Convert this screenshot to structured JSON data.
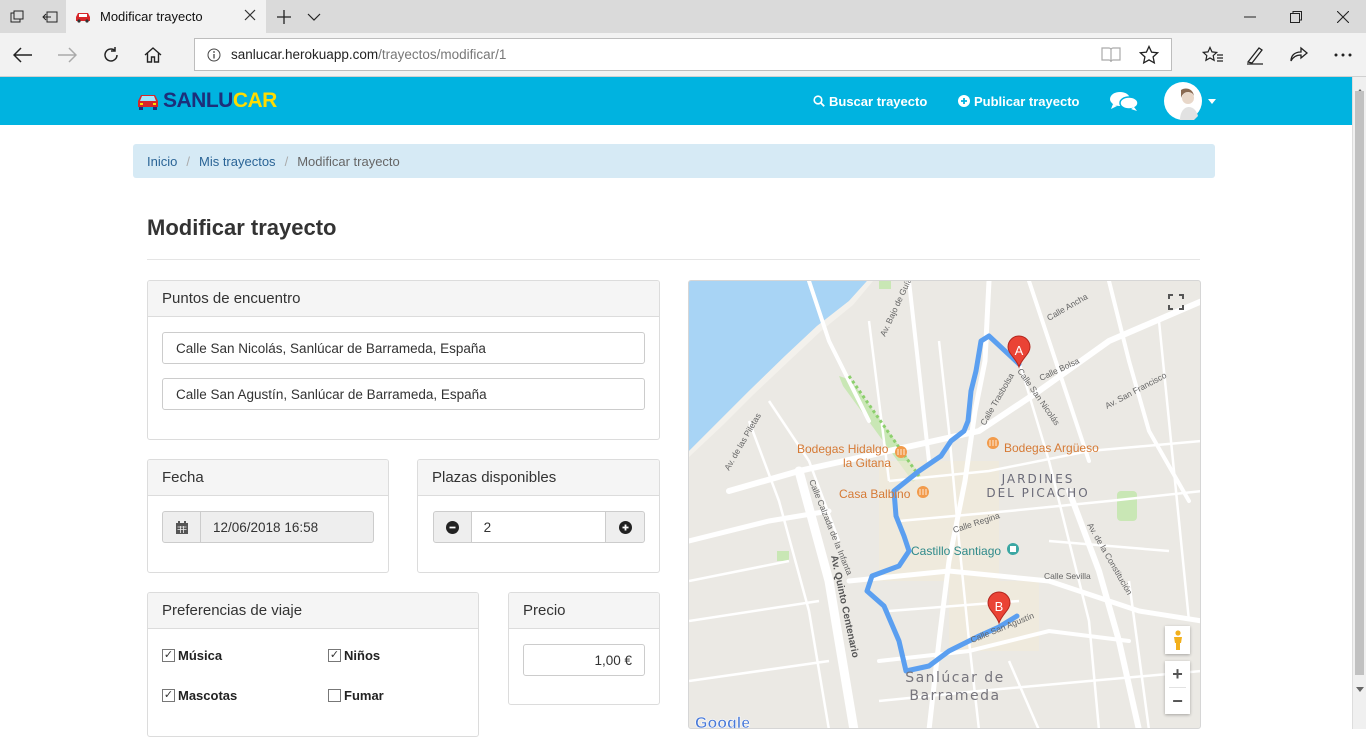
{
  "browser": {
    "tab_title": "Modificar trayecto",
    "url_host": "sanlucar.herokuapp.com",
    "url_path": "/trayectos/modificar/1",
    "icons": [
      "tab-manager-icon",
      "back-tabs-icon",
      "car-favicon",
      "close-icon",
      "plus-icon",
      "chevron-down-icon",
      "minimize-icon",
      "restore-icon",
      "close-window-icon",
      "back-arrow-icon",
      "forward-arrow-icon",
      "refresh-icon",
      "home-icon",
      "info-icon",
      "reading-view-icon",
      "star-icon",
      "favorites-icon",
      "pen-icon",
      "share-icon",
      "more-icon"
    ]
  },
  "navbar": {
    "logo_part1": "SANLU",
    "logo_part2": "CAR",
    "search_label": "Buscar trayecto",
    "publish_label": "Publicar trayecto",
    "brand_colors": {
      "bar": "#00b3e0",
      "logo_blue": "#1d2f7a",
      "logo_yellow": "#ffdc00",
      "logo_car": "#d7262a"
    }
  },
  "breadcrumb": {
    "items": [
      "Inicio",
      "Mis trayectos"
    ],
    "current": "Modificar trayecto"
  },
  "page": {
    "title": "Modificar trayecto"
  },
  "meeting_points": {
    "heading": "Puntos de encuentro",
    "origin": "Calle San Nicolás, Sanlúcar de Barrameda, España",
    "destination": "Calle San Agustín, Sanlúcar de Barrameda, España"
  },
  "date": {
    "heading": "Fecha",
    "value": "12/06/2018 16:58"
  },
  "seats": {
    "heading": "Plazas disponibles",
    "value": "2"
  },
  "preferences": {
    "heading": "Preferencias de viaje",
    "options": [
      {
        "label": "Música",
        "checked": true
      },
      {
        "label": "Niños",
        "checked": true
      },
      {
        "label": "Mascotas",
        "checked": true
      },
      {
        "label": "Fumar",
        "checked": false
      }
    ]
  },
  "price": {
    "heading": "Precio",
    "value": "1,00 €"
  },
  "map": {
    "marker_a": "A",
    "marker_b": "B",
    "district_line1": "JARDINES",
    "district_line2": "DEL PICACHO",
    "town_line1": "Sanlúcar de",
    "town_line2": "Barrameda",
    "poi": [
      "Bodegas Hidalgo",
      "la Gitana",
      "Bodegas Argüeso",
      "Casa Balbino",
      "Castillo Santiago"
    ],
    "streets": [
      "Av. Bajo de Guía",
      "Calle Sevilla",
      "Av. Quinto Centenario",
      "Calle San Agustín",
      "Calle San Nicolás",
      "Calle Regina",
      "Calle Bolsa",
      "Av. San Francisco",
      "Av. de la Constitución",
      "Calle Calzada de la Infanta",
      "Av. de las Piletas",
      "Calle Trasbolsa",
      "Calle Ancha"
    ],
    "google_logo": "Google",
    "zoom_in": "+",
    "zoom_out": "−",
    "route_color": "#5b9ff0",
    "marker_color": "#ea4335"
  }
}
